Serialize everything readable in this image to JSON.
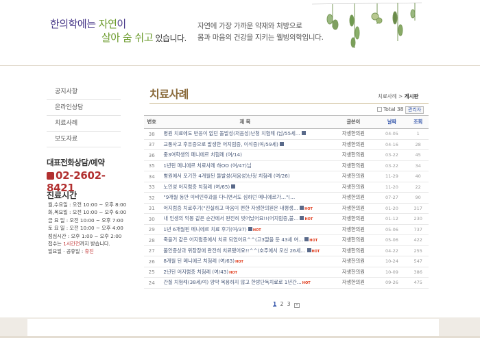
{
  "header": {
    "slogan_a": "한의학에는 ",
    "slogan_b": "자연",
    "slogan_c": "이",
    "slogan_d": "살아 숨 쉬고",
    "slogan_e": " 있습니다.",
    "sub_line1": "자연에 가장 가까운 약재와 처방으로",
    "sub_line2": "몸과 마음의 건강을 지키는 웰빙의학입니다."
  },
  "sidebar": {
    "items": [
      {
        "label": "공지사항"
      },
      {
        "label": "온라인상담"
      },
      {
        "label": "치료사례"
      },
      {
        "label": "보도자료"
      }
    ],
    "phone_title": "대표전화상담/예약",
    "phone_number": "02-2602-8421",
    "hours_title": "진료시간",
    "hours": [
      "월,수요일 : 오전 10:00 ~ 오후 8:00",
      "화,목요일 : 오전 10:00 ~ 오후 6:00",
      "금 요 일 : 오전 10:00 ~ 오후 7:00",
      "토 요 일 : 오전 10:00 ~ 오후 4:00",
      "점심시간 : 오후 1:00 ~ 오후 2:00"
    ],
    "note_a": "접수는 ",
    "note_b": "1시간전",
    "note_c": "까지 받습니다.",
    "holiday_a": "일요일 · 공휴일 : ",
    "holiday_b": "휴진"
  },
  "main": {
    "title": "치료사례",
    "breadcrumb_parent": "치료사례",
    "breadcrumb_sep": " > ",
    "breadcrumb_current": "게시판",
    "total_label": "Total 38",
    "admin_label": "관리자",
    "columns": {
      "num": "번호",
      "subject": "제 목",
      "author": "글쓴이",
      "date": "날짜",
      "views": "조회"
    },
    "rows": [
      {
        "num": "38",
        "subject": "병원 치료에도 반응이 없던 돌발성(저음성)난청 치험례 (남/55세…",
        "icon": true,
        "hot": false,
        "author": "자생한의원",
        "date": "04-05",
        "views": "1"
      },
      {
        "num": "37",
        "subject": "교통사고 후유증으로 발생한 어지럼증, 이석증(여/59세)",
        "icon": true,
        "hot": false,
        "author": "자생한의원",
        "date": "04-16",
        "views": "28"
      },
      {
        "num": "36",
        "subject": "중3여학생의 메니에르 치험례 (여/14)",
        "icon": false,
        "hot": false,
        "author": "자생한의원",
        "date": "03-22",
        "views": "45"
      },
      {
        "num": "35",
        "subject": "1년된 메니에르 치료사례 하OO (여/47)님",
        "icon": false,
        "hot": false,
        "author": "자생한의원",
        "date": "03-22",
        "views": "34"
      },
      {
        "num": "34",
        "subject": "병원에서 포기한 4개월된 돌발성(저음성)난청 치험례 (여/26)",
        "icon": false,
        "hot": false,
        "author": "자생한의원",
        "date": "11-29",
        "views": "40"
      },
      {
        "num": "33",
        "subject": "노인성 어지럼증 치험례 (여/65)",
        "icon": true,
        "hot": false,
        "author": "자생한의원",
        "date": "11-20",
        "views": "22"
      },
      {
        "num": "32",
        "subject": "\"9개월 동안 이비인후과를 다니면서도 심하던 메니에르가…\"(…",
        "icon": false,
        "hot": false,
        "author": "자생한의원",
        "date": "07-27",
        "views": "90"
      },
      {
        "num": "31",
        "subject": "어지럼증 치료후기(\"진실하고 마음이 편한 자생한의원은 내평생…",
        "icon": true,
        "hot": true,
        "author": "자생한의원",
        "date": "01-20",
        "views": "317"
      },
      {
        "num": "30",
        "subject": "내 인생의 악몽 같은 순간에서 완전히 벗어났어요!!(어지럼증,불…",
        "icon": true,
        "hot": true,
        "author": "자생한의원",
        "date": "01-12",
        "views": "230"
      },
      {
        "num": "29",
        "subject": "1년 6개월된 메니에르 치료 후기(여/37)",
        "icon": true,
        "hot": true,
        "author": "자생한의원",
        "date": "05-06",
        "views": "737"
      },
      {
        "num": "28",
        "subject": "죽을거 같은 어지럼증에서 치료 되었어요^^(고3딸을 둔 43세 여…",
        "icon": true,
        "hot": true,
        "author": "자생한의원",
        "date": "05-06",
        "views": "422"
      },
      {
        "num": "27",
        "subject": "불안증상과 위장장애 완전히 치료됐어요!!^^(호주에서 오신 26세…",
        "icon": true,
        "hot": true,
        "author": "자생한의원",
        "date": "04-22",
        "views": "255"
      },
      {
        "num": "26",
        "subject": "8개월 된 메니에르 치험례 (여/63)",
        "icon": false,
        "hot": true,
        "author": "자생한의원",
        "date": "10-24",
        "views": "547"
      },
      {
        "num": "25",
        "subject": "2년된 어지럼증 치험례 (여/43)",
        "icon": false,
        "hot": true,
        "author": "자생한의원",
        "date": "10-09",
        "views": "386"
      },
      {
        "num": "24",
        "subject": "간질 치험례(38세/여) 양약 복용하지 않고 한방단독치료로 1년간…",
        "icon": false,
        "hot": true,
        "author": "자생한의원",
        "date": "09-26",
        "views": "475"
      }
    ],
    "hot_label": "HOT",
    "pages": [
      "1",
      "2",
      "3"
    ],
    "next_label": "»"
  }
}
